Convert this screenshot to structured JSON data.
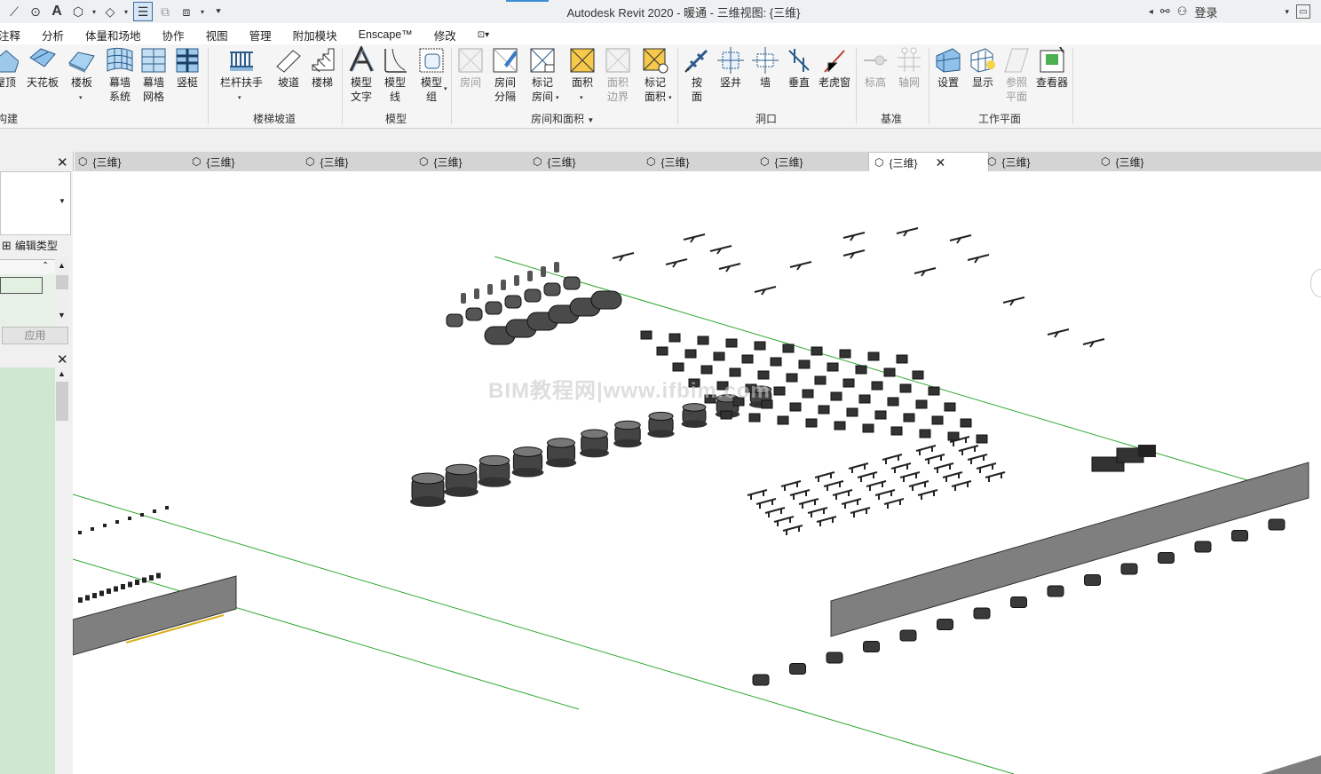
{
  "app": {
    "title": "Autodesk Revit 2020 - 暖通 - 三维视图: {三维}",
    "login_label": "登录"
  },
  "ribbon_tabs": [
    "注释",
    "分析",
    "体量和场地",
    "协作",
    "视图",
    "管理",
    "附加模块",
    "Enscape™",
    "修改"
  ],
  "ribbon": {
    "buttons": [
      {
        "id": "roof",
        "label": "屋顶"
      },
      {
        "id": "ceiling",
        "label": "天花板"
      },
      {
        "id": "floor",
        "label": "楼板"
      },
      {
        "id": "curtain-system",
        "label": "幕墙\n系统"
      },
      {
        "id": "curtain-grid",
        "label": "幕墙\n网格"
      },
      {
        "id": "mullion",
        "label": "竖梃"
      },
      {
        "id": "railing",
        "label": "栏杆扶手"
      },
      {
        "id": "ramp",
        "label": "坡道"
      },
      {
        "id": "stair",
        "label": "楼梯"
      },
      {
        "id": "model-text",
        "label": "模型\n文字"
      },
      {
        "id": "model-line",
        "label": "模型\n线"
      },
      {
        "id": "model-group",
        "label": "模型\n组"
      },
      {
        "id": "room",
        "label": "房间"
      },
      {
        "id": "room-separator",
        "label": "房间\n分隔"
      },
      {
        "id": "tag-room",
        "label": "标记\n房间"
      },
      {
        "id": "area",
        "label": "面积"
      },
      {
        "id": "area-boundary",
        "label": "面积\n边界"
      },
      {
        "id": "tag-area",
        "label": "标记\n面积"
      },
      {
        "id": "by-face",
        "label": "按\n面"
      },
      {
        "id": "shaft",
        "label": "竖井"
      },
      {
        "id": "wall-opening",
        "label": "墙"
      },
      {
        "id": "vertical",
        "label": "垂直"
      },
      {
        "id": "dormer",
        "label": "老虎窗"
      },
      {
        "id": "level",
        "label": "标高"
      },
      {
        "id": "grid",
        "label": "轴网"
      },
      {
        "id": "set",
        "label": "设置"
      },
      {
        "id": "show",
        "label": "显示"
      },
      {
        "id": "ref-plane",
        "label": "参照\n平面"
      },
      {
        "id": "viewer",
        "label": "查看器"
      }
    ],
    "panels": [
      "构建",
      "楼梯坡道",
      "模型",
      "房间和面积",
      "洞口",
      "基准",
      "工作平面"
    ]
  },
  "view_tabs": [
    "{三维}",
    "{三维}",
    "{三维}",
    "{三维}",
    "{三维}",
    "{三维}",
    "{三维}",
    "{三维}",
    "{三维}",
    "{三维}"
  ],
  "active_view_tab": 7,
  "properties": {
    "edit_type_label": "编辑类型",
    "apply_label": "应用"
  },
  "watermark": "BIM教程网|www.ifbim.com"
}
